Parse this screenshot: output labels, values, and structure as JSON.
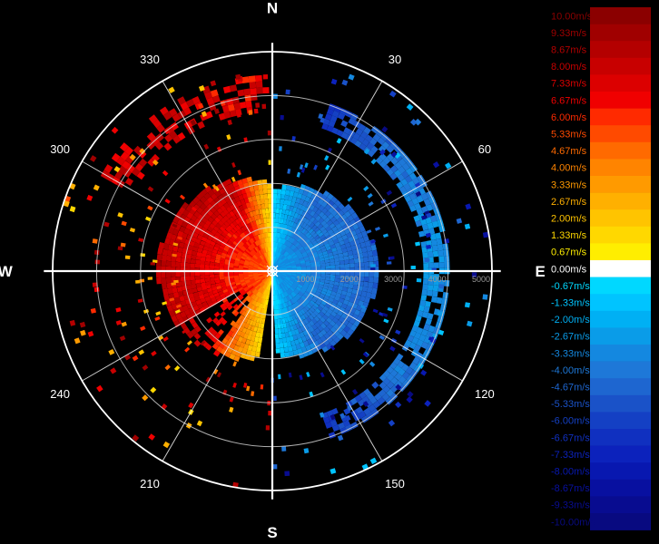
{
  "chart_data": {
    "type": "heatmap",
    "projection": "polar",
    "title": "",
    "compass_labels": [
      "N",
      "E",
      "S",
      "W"
    ],
    "bearing_labels": [
      "30",
      "60",
      "120",
      "150",
      "210",
      "240",
      "300",
      "330"
    ],
    "range_labels": [
      "1000",
      "2000",
      "3000",
      "4000",
      "5000"
    ],
    "range_max": 5000,
    "legend": {
      "position": "right",
      "labels": [
        "10.00m/s",
        "9.33m/s",
        "8.67m/s",
        "8.00m/s",
        "7.33m/s",
        "6.67m/s",
        "6.00m/s",
        "5.33m/s",
        "4.67m/s",
        "4.00m/s",
        "3.33m/s",
        "2.67m/s",
        "2.00m/s",
        "1.33m/s",
        "0.67m/s",
        "0.00m/s",
        "-0.67m/s",
        "-1.33m/s",
        "-2.00m/s",
        "-2.67m/s",
        "-3.33m/s",
        "-4.00m/s",
        "-4.67m/s",
        "-5.33m/s",
        "-6.00m/s",
        "-6.67m/s",
        "-7.33m/s",
        "-8.00m/s",
        "-8.67m/s",
        "-9.33m/s",
        "-10.00m/s"
      ],
      "colors": [
        "#8b0000",
        "#a00000",
        "#b40000",
        "#c80000",
        "#dc0000",
        "#f00000",
        "#ff2a00",
        "#ff4a00",
        "#ff6a00",
        "#ff8400",
        "#ff9a00",
        "#ffb000",
        "#ffc400",
        "#ffd800",
        "#ffee00",
        "#ffffff",
        "#00d8ff",
        "#00c4ff",
        "#00b0f4",
        "#0a9ce8",
        "#1488e0",
        "#1e78d8",
        "#1e66d0",
        "#1a52c8",
        "#1440c4",
        "#1030c0",
        "#0c22bc",
        "#0818b0",
        "#0810a0",
        "#080c90",
        "#080a80"
      ]
    },
    "series": [
      {
        "region": "west (receding, positive)",
        "bearing_range": [
          190,
          358
        ],
        "range_max": 2600,
        "velocity_min": 0.0,
        "velocity_max": 10.0
      },
      {
        "region": "east (approaching, negative)",
        "bearing_range": [
          2,
          178
        ],
        "range_max": 2600,
        "velocity_min": -6.0,
        "velocity_max": 0.0
      },
      {
        "region": "outer ring arc",
        "bearing_range": [
          20,
          160
        ],
        "range_min": 3500,
        "range_max": 4000,
        "velocity_min": -8.0,
        "velocity_max": -3.0
      }
    ],
    "grid": true
  }
}
